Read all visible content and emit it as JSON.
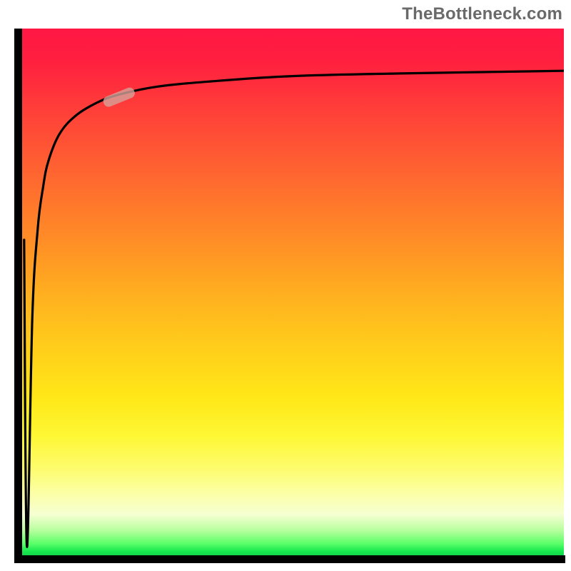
{
  "attribution": "TheBottleneck.com",
  "colors": {
    "axis": "#000000",
    "curve": "#000000",
    "marker_fill": "#d5a39a",
    "marker_opacity": 0.8,
    "gradient_top": "#ff1744",
    "gradient_bottom": "#0fd24a",
    "attribution_text": "#6a6a6a"
  },
  "chart_data": {
    "type": "line",
    "title": "",
    "xlabel": "",
    "ylabel": "",
    "xlim": [
      0,
      100
    ],
    "ylim": [
      0,
      100
    ],
    "grid": false,
    "legend": false,
    "series": [
      {
        "name": "percentage-curve",
        "x": [
          0.5,
          1,
          2,
          3,
          4,
          5,
          7,
          10,
          14,
          18,
          25,
          35,
          50,
          70,
          100
        ],
        "y": [
          60,
          2,
          45,
          62,
          70,
          75,
          80,
          83.5,
          86,
          87.5,
          89,
          90,
          91,
          91.5,
          92
        ]
      }
    ],
    "annotations": [
      {
        "name": "highlight-slug",
        "x": 18,
        "y": 87,
        "shape": "pill",
        "angle_deg": -22
      }
    ]
  }
}
